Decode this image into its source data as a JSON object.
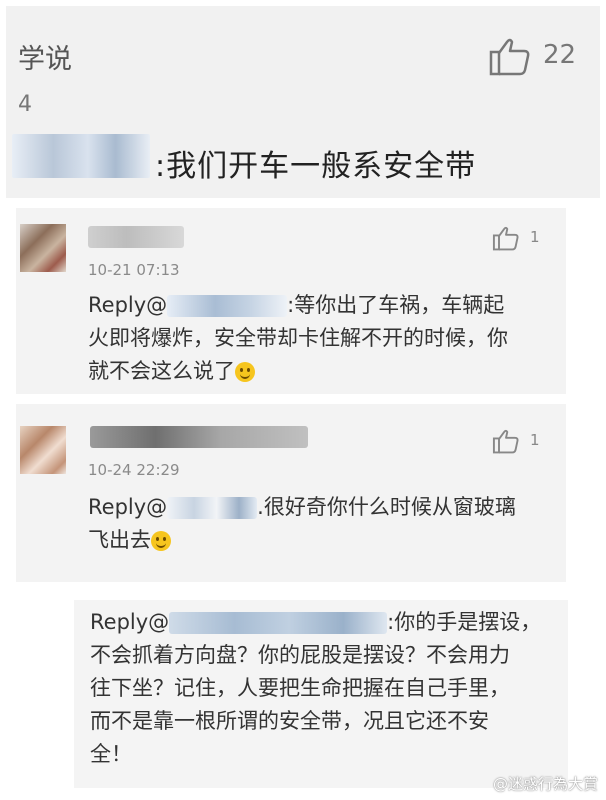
{
  "post": {
    "title": "学说",
    "number": "4",
    "likes": "22",
    "quote_text": ":我们开车一般系安全带"
  },
  "comments": [
    {
      "time": "10-21 07:13",
      "likes": "1",
      "reply_prefix": "Reply@",
      "line1_tail": ":等你出了车祸，车辆起",
      "line2": "火即将爆炸，安全带却卡住解不开的时候，你",
      "line3": "就不会这么说了"
    },
    {
      "time": "10-24 22:29",
      "likes": "1",
      "reply_prefix": "Reply@",
      "line1_tail": ".很好奇你什么时候从窗玻璃",
      "line2": "飞出去"
    },
    {
      "reply_prefix": "Reply@",
      "line1_tail": ":你的手是摆设，",
      "line2": "不会抓着方向盘？你的屁股是摆设？不会用力",
      "line3": "往下坐？记住，人要把生命把握在自己手里，",
      "line4": "而不是靠一根所谓的安全带，况且它还不安",
      "line5": "全！"
    }
  ],
  "watermark": "@迷惑行為大賞",
  "icons": {
    "like": "thumbs-up-icon",
    "emoji": "smiley-face-icon"
  }
}
